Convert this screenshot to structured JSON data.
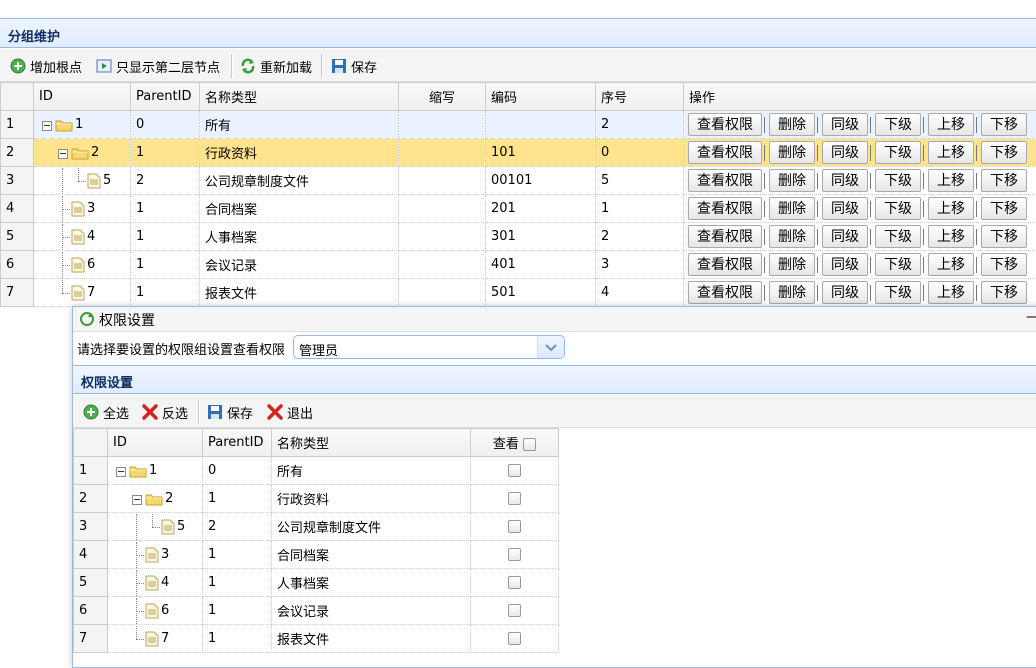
{
  "panel": {
    "title": "分组维护"
  },
  "toolbar": {
    "add_root": "增加根点",
    "show_second": "只显示第二层节点",
    "reload": "重新加载",
    "save": "保存"
  },
  "grid": {
    "headers": {
      "id": "ID",
      "parent": "ParentID",
      "name": "名称类型",
      "abbr": "缩写",
      "code": "编码",
      "order": "序号",
      "ops": "操作"
    },
    "op_labels": {
      "view": "查看权限",
      "delete": "删除",
      "same": "同级",
      "down_level": "下级",
      "up": "上移",
      "down": "下移"
    },
    "rows": [
      {
        "rn": "1",
        "id": "1",
        "parent": "0",
        "name": "所有",
        "abbr": "",
        "code": "",
        "order": "2"
      },
      {
        "rn": "2",
        "id": "2",
        "parent": "1",
        "name": "行政资料",
        "abbr": "",
        "code": "101",
        "order": "0"
      },
      {
        "rn": "3",
        "id": "5",
        "parent": "2",
        "name": "公司规章制度文件",
        "abbr": "",
        "code": "00101",
        "order": "5"
      },
      {
        "rn": "4",
        "id": "3",
        "parent": "1",
        "name": "合同档案",
        "abbr": "",
        "code": "201",
        "order": "1"
      },
      {
        "rn": "5",
        "id": "4",
        "parent": "1",
        "name": "人事档案",
        "abbr": "",
        "code": "301",
        "order": "2"
      },
      {
        "rn": "6",
        "id": "6",
        "parent": "1",
        "name": "会议记录",
        "abbr": "",
        "code": "401",
        "order": "3"
      },
      {
        "rn": "7",
        "id": "7",
        "parent": "1",
        "name": "报表文件",
        "abbr": "",
        "code": "501",
        "order": "4"
      }
    ]
  },
  "dialog": {
    "title": "权限设置",
    "minimize": "—",
    "prompt": "请选择要设置的权限组设置查看权限",
    "group_value": "管理员",
    "sub_title": "权限设置",
    "toolbar": {
      "select_all": "全选",
      "invert": "反选",
      "save": "保存",
      "exit": "退出"
    },
    "headers": {
      "id": "ID",
      "parent": "ParentID",
      "name": "名称类型",
      "view": "查看"
    },
    "rows": [
      {
        "rn": "1",
        "id": "1",
        "parent": "0",
        "name": "所有"
      },
      {
        "rn": "2",
        "id": "2",
        "parent": "1",
        "name": "行政资料"
      },
      {
        "rn": "3",
        "id": "5",
        "parent": "2",
        "name": "公司规章制度文件"
      },
      {
        "rn": "4",
        "id": "3",
        "parent": "1",
        "name": "合同档案"
      },
      {
        "rn": "5",
        "id": "4",
        "parent": "1",
        "name": "人事档案"
      },
      {
        "rn": "6",
        "id": "6",
        "parent": "1",
        "name": "会议记录"
      },
      {
        "rn": "7",
        "id": "7",
        "parent": "1",
        "name": "报表文件"
      }
    ]
  },
  "colors": {
    "selected_row": "#ffe48d",
    "header_title": "#0e2d5f",
    "border_blue": "#95b8e7"
  }
}
